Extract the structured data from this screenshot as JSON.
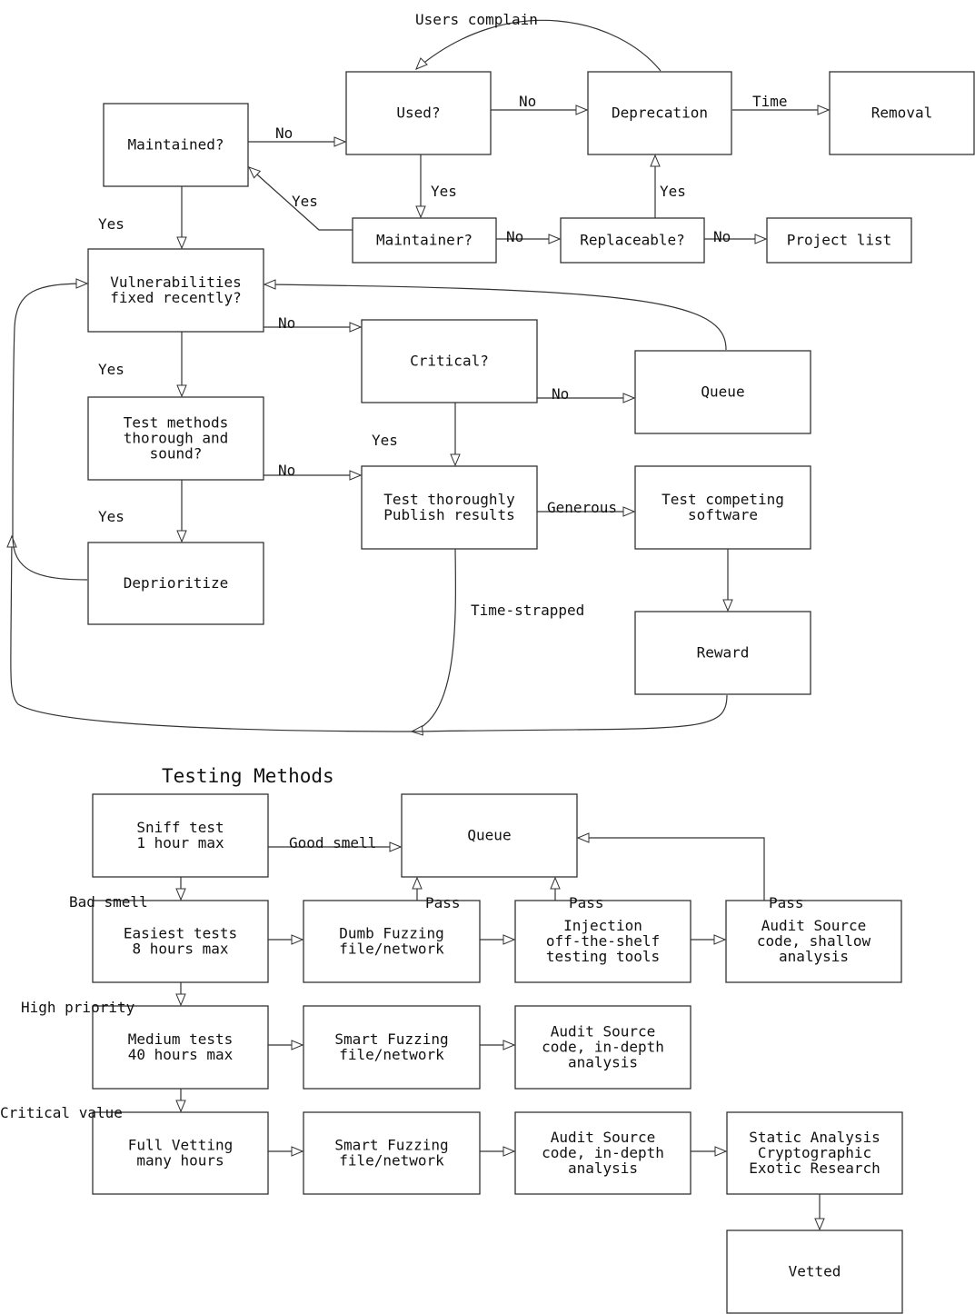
{
  "diagram": {
    "sections": [
      {
        "id": "triage",
        "title": ""
      },
      {
        "id": "testing",
        "title": "Testing Methods"
      }
    ],
    "nodes": [
      {
        "id": "maintained",
        "section": "triage",
        "lines": [
          "Maintained?"
        ]
      },
      {
        "id": "used",
        "section": "triage",
        "lines": [
          "Used?"
        ]
      },
      {
        "id": "deprecation",
        "section": "triage",
        "lines": [
          "Deprecation"
        ]
      },
      {
        "id": "removal",
        "section": "triage",
        "lines": [
          "Removal"
        ]
      },
      {
        "id": "maintainer",
        "section": "triage",
        "lines": [
          "Maintainer?"
        ]
      },
      {
        "id": "replaceable",
        "section": "triage",
        "lines": [
          "Replaceable?"
        ]
      },
      {
        "id": "project-list",
        "section": "triage",
        "lines": [
          "Project list"
        ]
      },
      {
        "id": "vuln-fixed",
        "section": "triage",
        "lines": [
          "Vulnerabilities",
          "fixed recently?"
        ]
      },
      {
        "id": "critical",
        "section": "triage",
        "lines": [
          "Critical?"
        ]
      },
      {
        "id": "queue-top",
        "section": "triage",
        "lines": [
          "Queue"
        ]
      },
      {
        "id": "test-methods",
        "section": "triage",
        "lines": [
          "Test methods",
          "thorough and",
          "sound?"
        ]
      },
      {
        "id": "test-thoroughly",
        "section": "triage",
        "lines": [
          "Test thoroughly",
          "Publish results"
        ]
      },
      {
        "id": "test-competing",
        "section": "triage",
        "lines": [
          "Test competing",
          "software"
        ]
      },
      {
        "id": "deprioritize",
        "section": "triage",
        "lines": [
          "Deprioritize"
        ]
      },
      {
        "id": "reward",
        "section": "triage",
        "lines": [
          "Reward"
        ]
      },
      {
        "id": "sniff",
        "section": "testing",
        "lines": [
          "Sniff test",
          "1 hour max"
        ]
      },
      {
        "id": "queue-bottom",
        "section": "testing",
        "lines": [
          "Queue"
        ]
      },
      {
        "id": "easiest",
        "section": "testing",
        "lines": [
          "Easiest tests",
          "8 hours max"
        ]
      },
      {
        "id": "dumb-fuzzing",
        "section": "testing",
        "lines": [
          "Dumb Fuzzing",
          "file/network"
        ]
      },
      {
        "id": "injection",
        "section": "testing",
        "lines": [
          "Injection",
          "off-the-shelf",
          "testing tools"
        ]
      },
      {
        "id": "audit-shallow",
        "section": "testing",
        "lines": [
          "Audit Source",
          "code, shallow",
          "analysis"
        ]
      },
      {
        "id": "medium",
        "section": "testing",
        "lines": [
          "Medium tests",
          "40 hours max"
        ]
      },
      {
        "id": "smart-fuzzing-1",
        "section": "testing",
        "lines": [
          "Smart Fuzzing",
          "file/network"
        ]
      },
      {
        "id": "audit-indepth-1",
        "section": "testing",
        "lines": [
          "Audit Source",
          "code, in-depth",
          "analysis"
        ]
      },
      {
        "id": "full-vetting",
        "section": "testing",
        "lines": [
          "Full Vetting",
          "many hours"
        ]
      },
      {
        "id": "smart-fuzzing-2",
        "section": "testing",
        "lines": [
          "Smart Fuzzing",
          "file/network"
        ]
      },
      {
        "id": "audit-indepth-2",
        "section": "testing",
        "lines": [
          "Audit Source",
          "code, in-depth",
          "analysis"
        ]
      },
      {
        "id": "static-analysis",
        "section": "testing",
        "lines": [
          "Static Analysis",
          "Cryptographic",
          "Exotic Research"
        ]
      },
      {
        "id": "vetted",
        "section": "testing",
        "lines": [
          "Vetted"
        ]
      }
    ],
    "edges": [
      {
        "id": "maintained-used",
        "from": "maintained",
        "to": "used",
        "label": "No"
      },
      {
        "id": "used-deprecation",
        "from": "used",
        "to": "deprecation",
        "label": "No"
      },
      {
        "id": "deprecation-removal",
        "from": "deprecation",
        "to": "removal",
        "label": "Time"
      },
      {
        "id": "deprecation-used",
        "from": "deprecation",
        "to": "used",
        "label": "Users complain"
      },
      {
        "id": "used-maintainer",
        "from": "used",
        "to": "maintainer",
        "label": "Yes"
      },
      {
        "id": "maintainer-maintained",
        "from": "maintainer",
        "to": "maintained",
        "label": "Yes"
      },
      {
        "id": "maintainer-replaceable",
        "from": "maintainer",
        "to": "replaceable",
        "label": "No"
      },
      {
        "id": "replaceable-deprecation",
        "from": "replaceable",
        "to": "deprecation",
        "label": "Yes"
      },
      {
        "id": "replaceable-projectlist",
        "from": "replaceable",
        "to": "project-list",
        "label": "No"
      },
      {
        "id": "maintained-vuln",
        "from": "maintained",
        "to": "vuln-fixed",
        "label": "Yes"
      },
      {
        "id": "vuln-critical",
        "from": "vuln-fixed",
        "to": "critical",
        "label": "No"
      },
      {
        "id": "vuln-testmethods",
        "from": "vuln-fixed",
        "to": "test-methods",
        "label": "Yes"
      },
      {
        "id": "critical-queue",
        "from": "critical",
        "to": "queue-top",
        "label": "No"
      },
      {
        "id": "critical-testthoroughly",
        "from": "critical",
        "to": "test-thoroughly",
        "label": "Yes"
      },
      {
        "id": "queue-vuln",
        "from": "queue-top",
        "to": "vuln-fixed",
        "label": ""
      },
      {
        "id": "testmethods-testthoroughly",
        "from": "test-methods",
        "to": "test-thoroughly",
        "label": "No"
      },
      {
        "id": "testmethods-deprioritize",
        "from": "test-methods",
        "to": "deprioritize",
        "label": "Yes"
      },
      {
        "id": "testthoroughly-competing",
        "from": "test-thoroughly",
        "to": "test-competing",
        "label": "Generous"
      },
      {
        "id": "competing-reward",
        "from": "test-competing",
        "to": "reward",
        "label": ""
      },
      {
        "id": "testthoroughly-loop",
        "from": "test-thoroughly",
        "to": "vuln-fixed",
        "label": "Time-strapped"
      },
      {
        "id": "reward-loop",
        "from": "reward",
        "to": "vuln-fixed",
        "label": ""
      },
      {
        "id": "deprioritize-loop",
        "from": "deprioritize",
        "to": "vuln-fixed",
        "label": ""
      },
      {
        "id": "sniff-queue",
        "from": "sniff",
        "to": "queue-bottom",
        "label": "Good smell"
      },
      {
        "id": "sniff-easiest",
        "from": "sniff",
        "to": "easiest",
        "label": "Bad smell"
      },
      {
        "id": "easiest-dumb",
        "from": "easiest",
        "to": "dumb-fuzzing",
        "label": ""
      },
      {
        "id": "dumb-injection",
        "from": "dumb-fuzzing",
        "to": "injection",
        "label": ""
      },
      {
        "id": "injection-audit",
        "from": "injection",
        "to": "audit-shallow",
        "label": ""
      },
      {
        "id": "dumb-queue",
        "from": "dumb-fuzzing",
        "to": "queue-bottom",
        "label": "Pass"
      },
      {
        "id": "injection-queue",
        "from": "injection",
        "to": "queue-bottom",
        "label": "Pass"
      },
      {
        "id": "audit-queue",
        "from": "audit-shallow",
        "to": "queue-bottom",
        "label": "Pass"
      },
      {
        "id": "easiest-medium",
        "from": "easiest",
        "to": "medium",
        "label": "High priority"
      },
      {
        "id": "medium-smart1",
        "from": "medium",
        "to": "smart-fuzzing-1",
        "label": ""
      },
      {
        "id": "smart1-audit1",
        "from": "smart-fuzzing-1",
        "to": "audit-indepth-1",
        "label": ""
      },
      {
        "id": "medium-full",
        "from": "medium",
        "to": "full-vetting",
        "label": "Critical value"
      },
      {
        "id": "full-smart2",
        "from": "full-vetting",
        "to": "smart-fuzzing-2",
        "label": ""
      },
      {
        "id": "smart2-audit2",
        "from": "smart-fuzzing-2",
        "to": "audit-indepth-2",
        "label": ""
      },
      {
        "id": "audit2-static",
        "from": "audit-indepth-2",
        "to": "static-analysis",
        "label": ""
      },
      {
        "id": "static-vetted",
        "from": "static-analysis",
        "to": "vetted",
        "label": ""
      }
    ]
  }
}
